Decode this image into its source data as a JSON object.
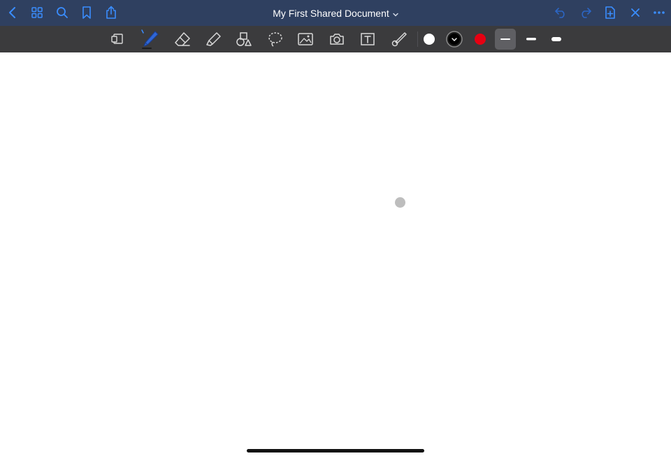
{
  "document": {
    "title": "My First Shared Document"
  },
  "topbar": {
    "left_icons": [
      "back-chevron-icon",
      "grid-icon",
      "search-icon",
      "bookmark-icon",
      "share-icon"
    ],
    "right_icons": [
      "undo-icon",
      "redo-icon",
      "add-page-icon",
      "close-icon",
      "more-icon"
    ]
  },
  "toolbar": {
    "tools": [
      "page-layout-icon",
      "pen-icon",
      "eraser-icon",
      "highlighter-icon",
      "shapes-icon",
      "lasso-icon",
      "image-icon",
      "camera-icon",
      "text-box-icon",
      "laser-pointer-icon"
    ],
    "selected_tool": "pen",
    "colors": [
      "#ffffff",
      "#000000",
      "#e60012"
    ],
    "selected_color": "#000000",
    "stroke_widths": [
      "thin",
      "medium",
      "thick"
    ],
    "selected_stroke": "thin"
  },
  "colors": {
    "topbar_bg": "#2f4060",
    "toolbar_bg": "#3b3b3d",
    "accent": "#3a8dff"
  }
}
